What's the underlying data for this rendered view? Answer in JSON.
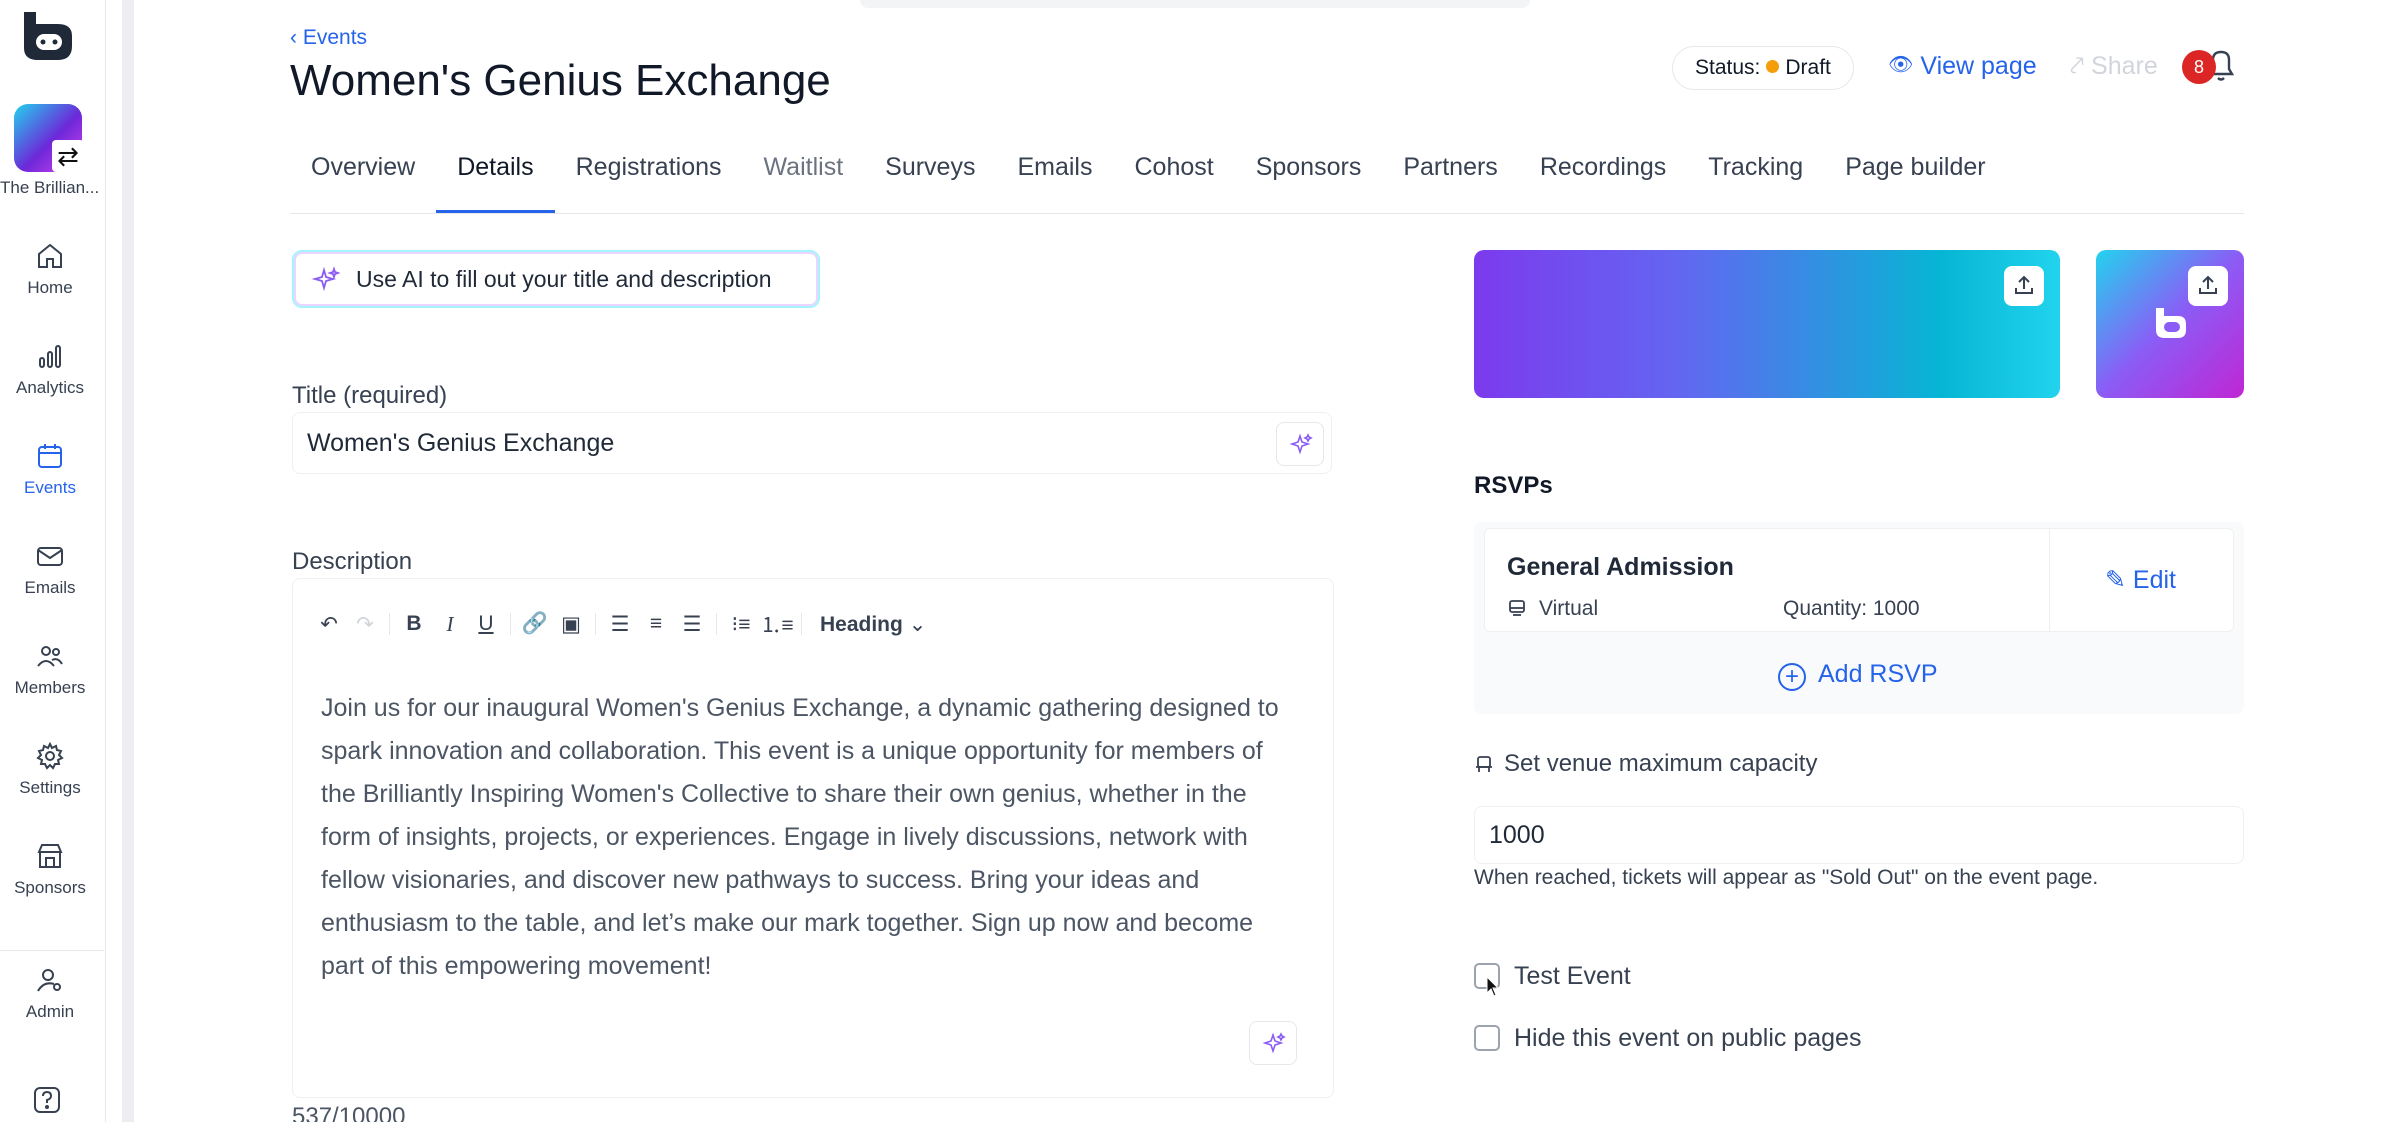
{
  "sidebar": {
    "org_name": "The Brillian...",
    "items": [
      {
        "label": "Home",
        "icon": "home-icon"
      },
      {
        "label": "Analytics",
        "icon": "analytics-icon"
      },
      {
        "label": "Events",
        "icon": "calendar-icon",
        "active": true
      },
      {
        "label": "Emails",
        "icon": "mail-icon"
      },
      {
        "label": "Members",
        "icon": "members-icon"
      },
      {
        "label": "Settings",
        "icon": "gear-icon"
      },
      {
        "label": "Sponsors",
        "icon": "storefront-icon"
      },
      {
        "label": "Admin",
        "icon": "admin-icon"
      }
    ]
  },
  "header": {
    "breadcrumb": "Events",
    "title": "Women's Genius Exchange",
    "status_label": "Status:",
    "status_value": "Draft",
    "view_page": "View page",
    "share": "Share",
    "notification_count": "8"
  },
  "tabs": [
    "Overview",
    "Details",
    "Registrations",
    "Waitlist",
    "Surveys",
    "Emails",
    "Cohost",
    "Sponsors",
    "Partners",
    "Recordings",
    "Tracking",
    "Page builder"
  ],
  "active_tab": "Details",
  "form": {
    "ai_button": "Use AI to fill out your title and description",
    "title_label": "Title (required)",
    "title_value": "Women's Genius Exchange",
    "description_label": "Description",
    "toolbar_heading": "Heading",
    "description_text": "Join us for our inaugural Women's Genius Exchange, a dynamic gathering designed to spark innovation and collaboration. This event is a unique opportunity for members of the Brilliantly Inspiring Women's Collective to share their own genius, whether in the form of insights, projects, or experiences. Engage in lively discussions, network with fellow visionaries, and discover new pathways to success. Bring your ideas and enthusiasm to the table, and let’s make our mark together. Sign up now and become part of this empowering movement!",
    "char_count": "537/10000"
  },
  "rsvps": {
    "title": "RSVPs",
    "items": [
      {
        "name": "General Admission",
        "type": "Virtual",
        "quantity": "Quantity: 1000",
        "edit": "Edit"
      }
    ],
    "add_label": "Add RSVP"
  },
  "venue": {
    "label": "Set venue maximum capacity",
    "value": "1000",
    "hint": "When reached, tickets will appear as \"Sold Out\" on the event page."
  },
  "options": {
    "test_event": "Test Event",
    "hide_event": "Hide this event on public pages"
  },
  "colors": {
    "accent": "#2563eb",
    "status_draft": "#f59e0b",
    "badge": "#dc2626"
  }
}
